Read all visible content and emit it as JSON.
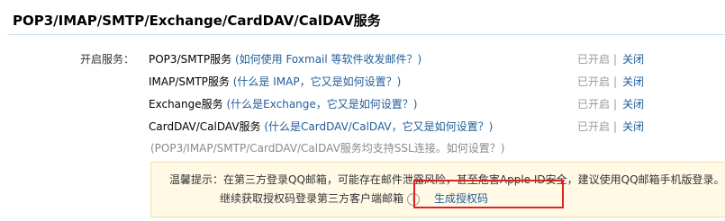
{
  "section": {
    "title": "POP3/IMAP/SMTP/Exchange/CardDAV/CalDAV服务"
  },
  "services": {
    "label": "开启服务：",
    "items": [
      {
        "name": "POP3/SMTP服务",
        "paren_open": " (",
        "help_link": "如何使用 Foxmail 等软件收发邮件？",
        "paren_close": ")",
        "status": "已开启",
        "separator": "|",
        "action": "关闭"
      },
      {
        "name": "IMAP/SMTP服务",
        "paren_open": " (",
        "help_link": "什么是 IMAP，它又是如何设置？",
        "paren_close": ")",
        "status": "已开启",
        "separator": "|",
        "action": "关闭"
      },
      {
        "name": "Exchange服务",
        "paren_open": " (",
        "help_link": "什么是Exchange，它又是如何设置？",
        "paren_close": ")",
        "status": "已开启",
        "separator": "|",
        "action": "关闭"
      },
      {
        "name": "CardDAV/CalDAV服务",
        "paren_open": " (",
        "help_link": "什么是CardDAV/CalDAV，它又是如何设置？",
        "paren_close": ")",
        "status": "已开启",
        "separator": "|",
        "action": "关闭"
      }
    ],
    "ssl_note_text": "(POP3/IMAP/SMTP/CardDAV/CalDAV服务均支持SSL连接。",
    "ssl_note_link": "如何设置？",
    "ssl_note_close": ")"
  },
  "tip": {
    "line1": "温馨提示：在第三方登录QQ邮箱，可能存在邮件泄露风险，甚至危害Apple ID安全，建议使用QQ邮箱手机版登录。",
    "line2": "继续获取授权码登录第三方客户端邮箱",
    "help_icon": "?",
    "generate_link": "生成授权码"
  }
}
